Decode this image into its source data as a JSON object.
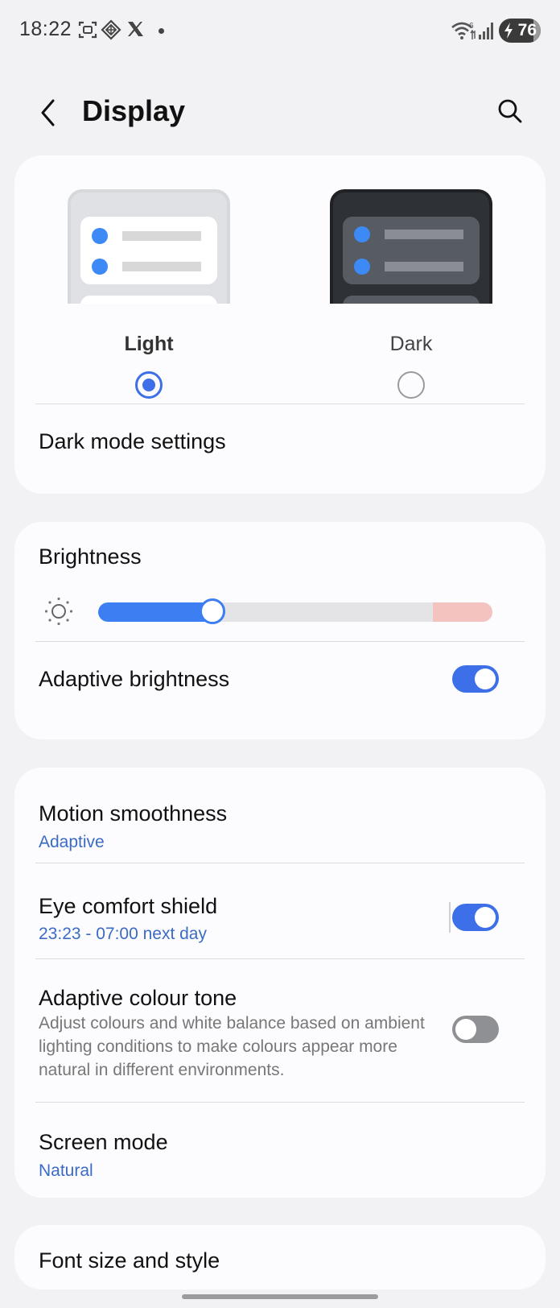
{
  "status_bar": {
    "time": "18:22",
    "icons": [
      "screenshot-icon",
      "app-icon",
      "x-logo-icon",
      "notification-dot",
      "wifi-icon",
      "signal-icon"
    ],
    "battery": "76"
  },
  "header": {
    "back_icon": "chevron-left-icon",
    "title": "Display",
    "search_icon": "search-icon"
  },
  "theme": {
    "options": [
      {
        "label": "Light",
        "selected": true
      },
      {
        "label": "Dark",
        "selected": false
      }
    ],
    "dark_mode_settings": "Dark mode settings"
  },
  "brightness": {
    "title": "Brightness",
    "level": 0.29,
    "adaptive_label": "Adaptive brightness",
    "adaptive_on": true
  },
  "settings": {
    "motion": {
      "title": "Motion smoothness",
      "value": "Adaptive"
    },
    "eye_comfort": {
      "title": "Eye comfort shield",
      "value": "23:23 - 07:00 next day",
      "on": true
    },
    "adaptive_tone": {
      "title": "Adaptive colour tone",
      "description": "Adjust colours and white balance based on ambient lighting conditions to make colours appear more natural in different environments.",
      "on": false
    },
    "screen_mode": {
      "title": "Screen mode",
      "value": "Natural"
    }
  },
  "font": {
    "title": "Font size and style"
  },
  "colors": {
    "accent": "#3d70e8",
    "link_text": "#3b6bc4",
    "background": "#f2f2f4",
    "card": "#fcfcfe"
  }
}
